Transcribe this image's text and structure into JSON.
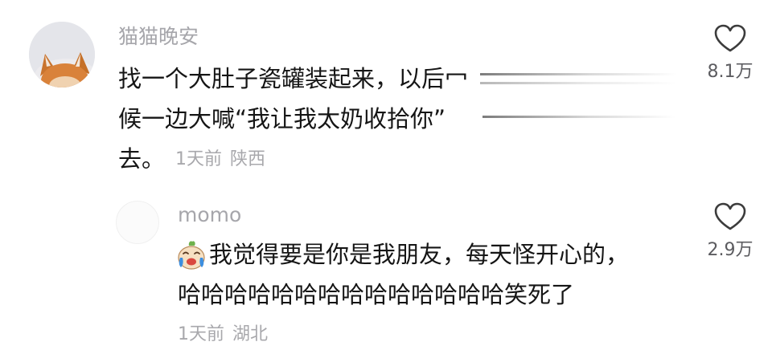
{
  "comment": {
    "username": "猫猫晚安",
    "text_lines": [
      "找一个大肚子瓷罐装起来，以后冖",
      "候一边大喊“我让我太奶收拾你”",
      "去。"
    ],
    "time": "1天前",
    "location": "陕西",
    "like_count": "8.1万",
    "avatar_icon": "shiba-dog-avatar",
    "like_icon": "heart-outline-icon"
  },
  "reply": {
    "username": "momo",
    "text_lines": [
      "我觉得要是你是我朋友，每天怪开心的，",
      "哈哈哈哈哈哈哈哈哈哈哈哈哈哈笑死了"
    ],
    "emoji_icon": "crying-laughing-emoji",
    "time": "1天前",
    "location": "湖北",
    "like_count": "2.9万",
    "like_icon": "heart-outline-icon"
  }
}
